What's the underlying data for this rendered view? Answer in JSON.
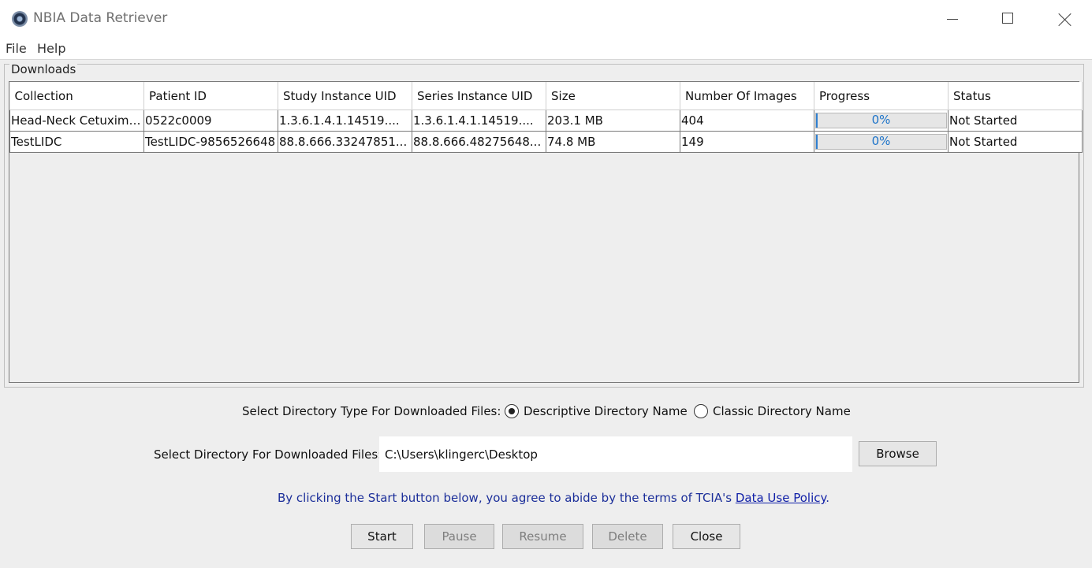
{
  "window": {
    "title": "NBIA Data Retriever",
    "icon": "app-logo-icon",
    "controls": [
      "minimize-icon",
      "maximize-icon",
      "close-icon"
    ]
  },
  "menu": {
    "file": "File",
    "help": "Help"
  },
  "downloads": {
    "group_label": "Downloads",
    "columns": [
      "Collection",
      "Patient ID",
      "Study Instance UID",
      "Series Instance UID",
      "Size",
      "Number Of Images",
      "Progress",
      "Status"
    ],
    "rows": [
      {
        "collection": "Head-Neck Cetuximab",
        "patient_id": "0522c0009",
        "study_uid": "1.3.6.1.4.1.14519....",
        "series_uid": "1.3.6.1.4.1.14519....",
        "size": "203.1 MB",
        "images": "404",
        "progress_label": "0%",
        "progress_value": 0,
        "status": "Not Started"
      },
      {
        "collection": "TestLIDC",
        "patient_id": "TestLIDC-9856526648",
        "study_uid": "88.8.666.33247851...",
        "series_uid": "88.8.666.48275648...",
        "size": "74.8 MB",
        "images": "149",
        "progress_label": "0%",
        "progress_value": 0,
        "status": "Not Started"
      }
    ]
  },
  "directory_type": {
    "label": "Select Directory Type For Downloaded Files:",
    "descriptive": "Descriptive Directory Name",
    "classic": "Classic Directory Name",
    "selected": "descriptive"
  },
  "directory": {
    "label": "Select Directory For Downloaded Files:",
    "value": "C:\\Users\\klingerc\\Desktop",
    "browse": "Browse"
  },
  "agreement": {
    "text": "By clicking the Start button below, you agree to abide by the terms of TCIA's",
    "link": "Data Use Policy",
    "period": "."
  },
  "buttons": {
    "start": "Start",
    "pause": "Pause",
    "resume": "Resume",
    "delete": "Delete",
    "close": "Close"
  },
  "colors": {
    "progress_fill": "#2f7fd0",
    "progress_text": "#1c73c9",
    "link": "#1120a8"
  }
}
